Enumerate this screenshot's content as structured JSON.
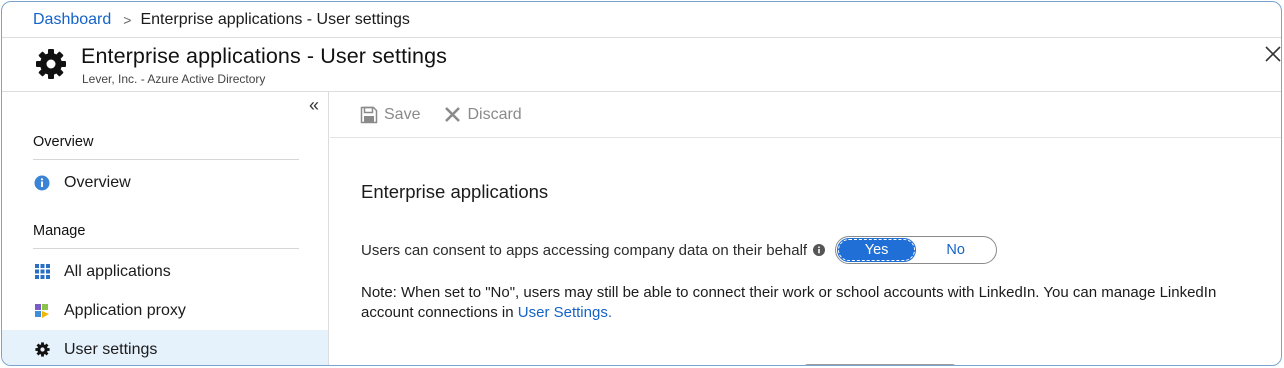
{
  "breadcrumb": {
    "root": "Dashboard",
    "separator": ">",
    "current": "Enterprise applications - User settings"
  },
  "header": {
    "title": "Enterprise applications - User settings",
    "subtitle": "Lever, Inc. - Azure Active Directory",
    "icon": "gear-icon",
    "close_icon": "close-icon"
  },
  "sidebar": {
    "collapse_glyph": "«",
    "sections": [
      {
        "label": "Overview",
        "items": [
          {
            "label": "Overview",
            "icon": "info-icon"
          }
        ]
      },
      {
        "label": "Manage",
        "items": [
          {
            "label": "All applications",
            "icon": "grid-icon"
          },
          {
            "label": "Application proxy",
            "icon": "app-proxy-icon"
          },
          {
            "label": "User settings",
            "icon": "gear-icon",
            "active": true
          }
        ]
      }
    ]
  },
  "toolbar": {
    "save_label": "Save",
    "discard_label": "Discard"
  },
  "main": {
    "section_heading": "Enterprise applications",
    "consent_label": "Users can consent to apps accessing company data on their behalf",
    "toggle": {
      "yes_label": "Yes",
      "no_label": "No",
      "selected": "Yes"
    },
    "note_text": "Note: When set to \"No\", users may still be able to connect their work or school accounts with LinkedIn. You can manage LinkedIn account connections in ",
    "note_link": "User Settings."
  },
  "colors": {
    "accent": "#1f6fd6",
    "link": "#1463c8",
    "active_nav_bg": "#e5f1fb",
    "frame_border": "#7aa3cf"
  }
}
